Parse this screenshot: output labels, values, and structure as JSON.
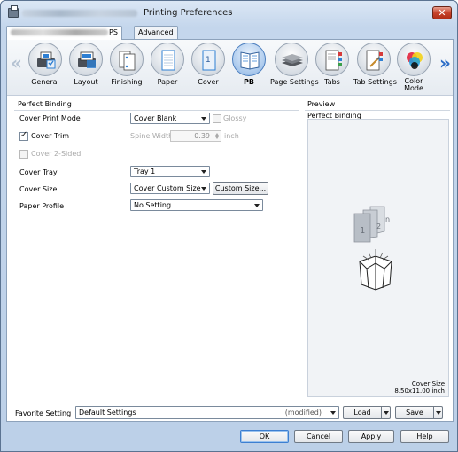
{
  "window": {
    "title": "Printing Preferences",
    "close_label": "✕"
  },
  "tabs": [
    {
      "label": "PS"
    },
    {
      "label": "Advanced"
    }
  ],
  "functions": [
    {
      "label": "General",
      "icon": "general-icon"
    },
    {
      "label": "Layout",
      "icon": "layout-icon"
    },
    {
      "label": "Finishing",
      "icon": "finishing-icon"
    },
    {
      "label": "Paper",
      "icon": "paper-icon"
    },
    {
      "label": "Cover",
      "icon": "cover-icon",
      "glyph": "1"
    },
    {
      "label": "PB",
      "icon": "perfect-binding-icon",
      "selected": true
    },
    {
      "label": "Page Settings",
      "icon": "page-settings-icon"
    },
    {
      "label": "Tabs",
      "icon": "tabs-icon"
    },
    {
      "label": "Tab Settings",
      "icon": "tab-settings-icon"
    },
    {
      "label": "Color\nMode",
      "icon": "color-mode-icon"
    }
  ],
  "scroll": {
    "left": "«",
    "right": "»"
  },
  "perfect_binding": {
    "section_title": "Perfect Binding",
    "cover_print_mode": {
      "label": "Cover Print Mode",
      "value": "Cover Blank"
    },
    "glossy": {
      "label": "Glossy",
      "checked": false,
      "enabled": false
    },
    "cover_trim": {
      "label": "Cover Trim",
      "checked": true
    },
    "spine_width": {
      "label": "Spine Width",
      "value": "0.39",
      "unit": "inch",
      "enabled": false
    },
    "cover_2_sided": {
      "label": "Cover 2-Sided",
      "checked": false,
      "enabled": false
    },
    "cover_tray": {
      "label": "Cover Tray",
      "value": "Tray 1"
    },
    "cover_size": {
      "label": "Cover Size",
      "value": "Cover Custom Size",
      "button": "Custom Size..."
    },
    "paper_profile": {
      "label": "Paper Profile",
      "value": "No Setting"
    }
  },
  "preview": {
    "section_title": "Preview",
    "subtitle": "Perfect Binding",
    "page_numbers": [
      "1",
      "2",
      "n"
    ],
    "cover_size_label": "Cover Size",
    "cover_size_value": "8.50x11.00 inch"
  },
  "favorite": {
    "label": "Favorite Setting",
    "value": "Default Settings",
    "state": "(modified)",
    "load": "Load",
    "save": "Save"
  },
  "buttons": {
    "ok": "OK",
    "cancel": "Cancel",
    "apply": "Apply",
    "help": "Help"
  },
  "colors": {
    "accent": "#2a6cc7",
    "window_frame": "#bcd0e8",
    "close": "#c7432b"
  }
}
